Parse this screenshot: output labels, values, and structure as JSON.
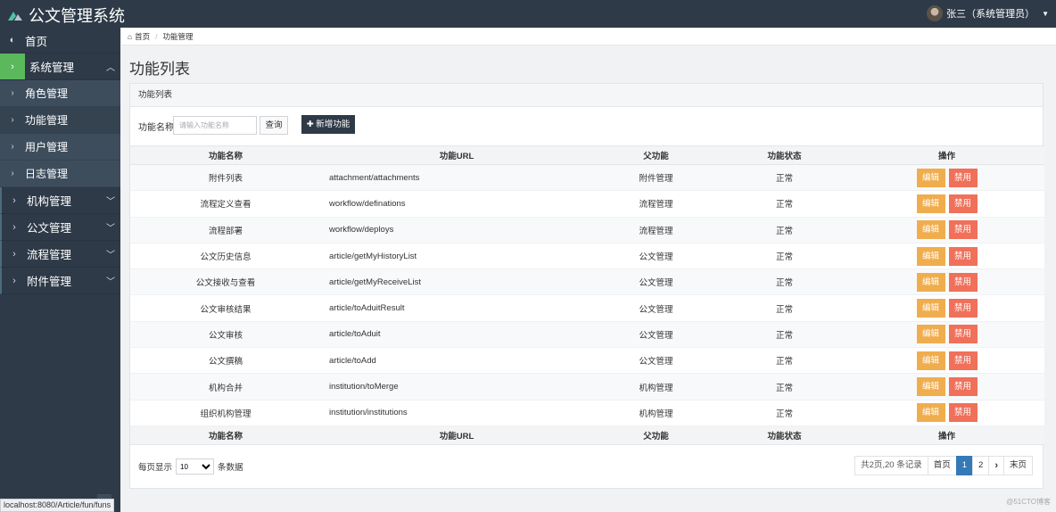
{
  "header": {
    "app_title": "公文管理系统",
    "user_label": "张三（系统管理员）"
  },
  "sidebar": {
    "home": "首页",
    "groups": [
      {
        "label": "系统管理",
        "expanded": true
      },
      {
        "label": "机构管理"
      },
      {
        "label": "公文管理"
      },
      {
        "label": "流程管理"
      },
      {
        "label": "附件管理"
      }
    ],
    "sub_items": [
      "角色管理",
      "功能管理",
      "用户管理",
      "日志管理"
    ]
  },
  "breadcrumb": {
    "home": "首页",
    "current": "功能管理"
  },
  "page": {
    "title": "功能列表"
  },
  "panel": {
    "heading": "功能列表",
    "search_label": "功能名称",
    "search_placeholder": "请输入功能名称",
    "query_button": "查询",
    "add_button": "新增功能"
  },
  "table": {
    "columns": [
      "功能名称",
      "功能URL",
      "父功能",
      "功能状态",
      "操作"
    ],
    "edit_label": "编辑",
    "disable_label": "禁用",
    "rows": [
      {
        "name": "附件列表",
        "url": "attachment/attachments",
        "parent": "附件管理",
        "state": "正常"
      },
      {
        "name": "流程定义查看",
        "url": "workflow/definations",
        "parent": "流程管理",
        "state": "正常"
      },
      {
        "name": "流程部署",
        "url": "workflow/deploys",
        "parent": "流程管理",
        "state": "正常"
      },
      {
        "name": "公文历史信息",
        "url": "article/getMyHistoryList",
        "parent": "公文管理",
        "state": "正常"
      },
      {
        "name": "公文接收与查看",
        "url": "article/getMyReceiveList",
        "parent": "公文管理",
        "state": "正常"
      },
      {
        "name": "公文审核结果",
        "url": "article/toAduitResult",
        "parent": "公文管理",
        "state": "正常"
      },
      {
        "name": "公文审核",
        "url": "article/toAduit",
        "parent": "公文管理",
        "state": "正常"
      },
      {
        "name": "公文撰稿",
        "url": "article/toAdd",
        "parent": "公文管理",
        "state": "正常"
      },
      {
        "name": "机构合并",
        "url": "institution/toMerge",
        "parent": "机构管理",
        "state": "正常"
      },
      {
        "name": "组织机构管理",
        "url": "institution/institutions",
        "parent": "机构管理",
        "state": "正常"
      }
    ]
  },
  "pagination": {
    "per_page_label": "每页显示",
    "per_page_value": "10",
    "per_page_suffix": "条数据",
    "summary": "共2页,20 条记录",
    "first": "首页",
    "pages": [
      "1",
      "2"
    ],
    "next": "›",
    "last": "末页",
    "current_page": 1
  },
  "status_bar": "localhost:8080/Article/fun/funs",
  "watermark": "@51CTO博客",
  "colors": {
    "sidebar": "#2e3a47",
    "active_marker": "#5cb85c",
    "edit": "#f0ad4e",
    "disable": "#f0705a",
    "page_active": "#337ab7"
  }
}
